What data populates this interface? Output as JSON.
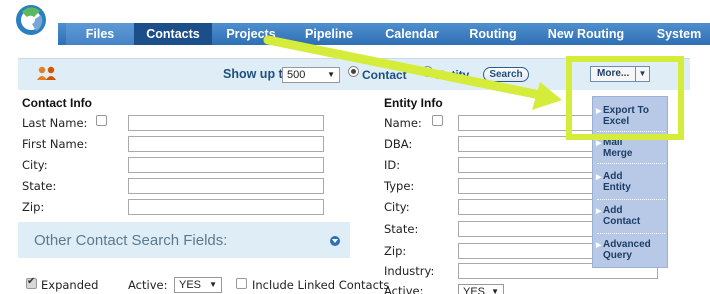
{
  "nav": {
    "tabs": [
      {
        "label": "Files"
      },
      {
        "label": "Contacts"
      },
      {
        "label": "Projects"
      },
      {
        "label": "Pipeline"
      },
      {
        "label": "Calendar"
      },
      {
        "label": "Routing"
      },
      {
        "label": "New Routing"
      },
      {
        "label": "System"
      }
    ],
    "active_tab": "Contacts"
  },
  "search": {
    "show_up_to_label": "Show up to:",
    "show_up_to_value": "500",
    "mode_contact_label": "Contact",
    "mode_entity_label": "Entity",
    "search_button": "Search"
  },
  "contact_info": {
    "heading": "Contact Info",
    "fields": [
      "Last Name:",
      "First Name:",
      "City:",
      "State:",
      "Zip:"
    ]
  },
  "entity_info": {
    "heading": "Entity Info",
    "fields": [
      "Name:",
      "DBA:",
      "ID:",
      "Type:",
      "City:",
      "State:",
      "Zip:",
      "Industry:",
      "Active:"
    ],
    "active_value": "YES"
  },
  "other_fields": {
    "label": "Other Contact Search Fields:"
  },
  "footer_options": {
    "expanded_label": "Expanded",
    "active_label": "Active:",
    "active_value": "YES",
    "linked_label": "Include Linked Contacts"
  },
  "more_menu": {
    "button_label": "More...",
    "items": [
      {
        "line1": "Export To",
        "line2": "Excel"
      },
      {
        "line1": "Mail",
        "line2": "Merge"
      },
      {
        "line1": "Add",
        "line2": "Entity"
      },
      {
        "line1": "Add",
        "line2": "Contact"
      },
      {
        "line1": "Advanced",
        "line2": "Query"
      }
    ]
  },
  "colors": {
    "nav_blue": "#2f6fb4",
    "active_tab": "#1c4f8a",
    "highlight": "#d5ed3a",
    "panel_bg": "#dfeef6"
  },
  "icons": {
    "logo": "app-logo-icon",
    "people": "people-icon",
    "dropdown": "chevron-down-icon"
  }
}
